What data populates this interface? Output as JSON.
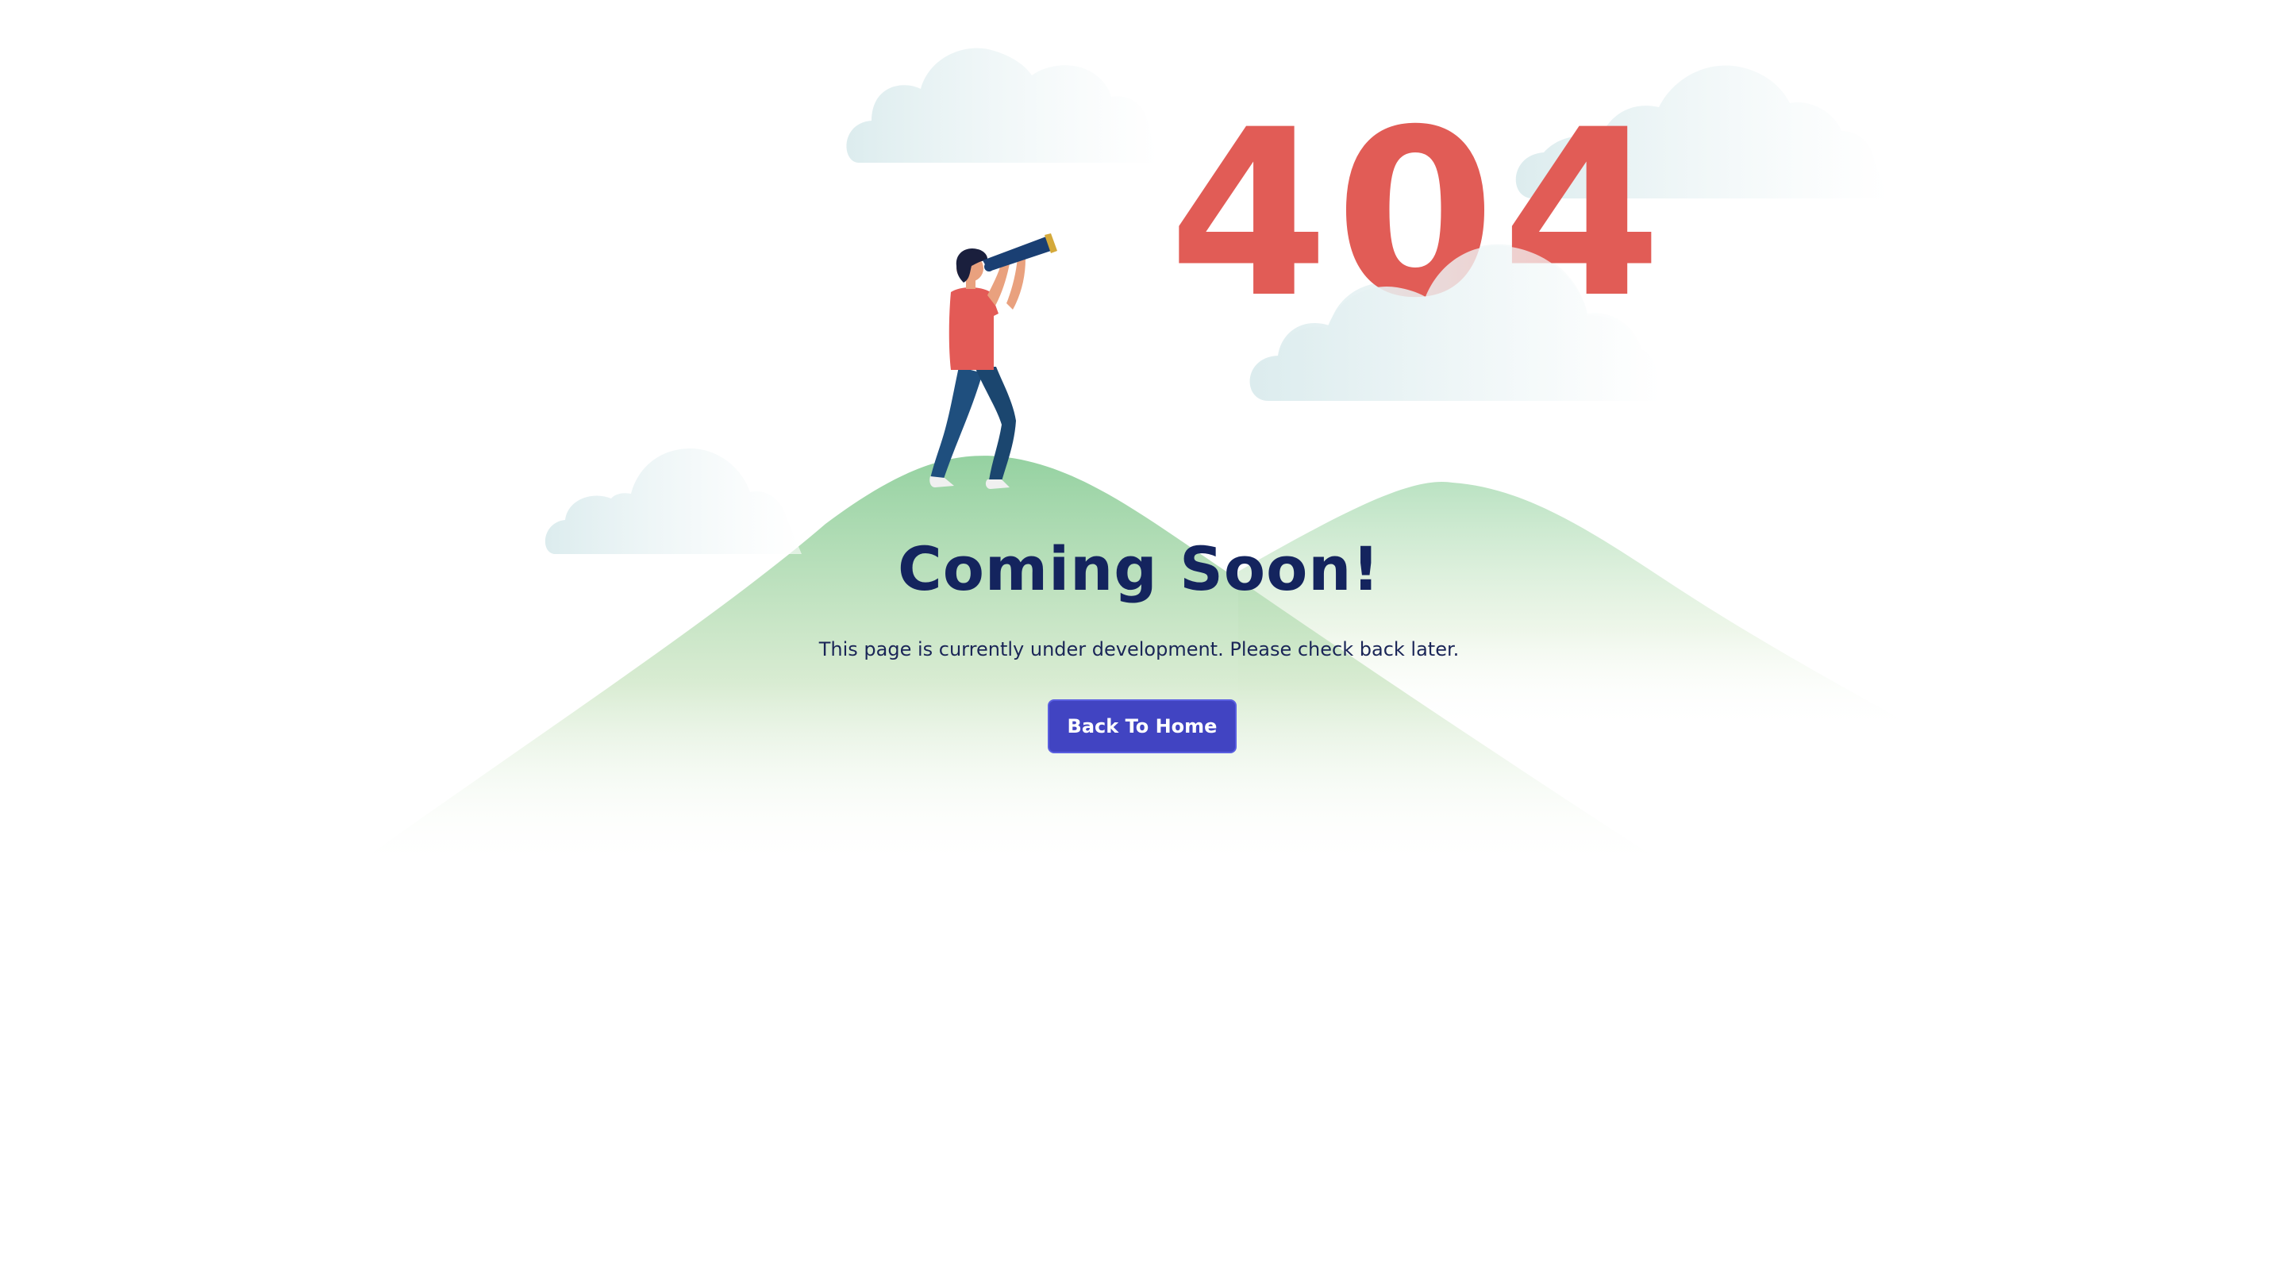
{
  "error_code": "404",
  "heading": "Coming Soon!",
  "message": "This page is currently under development. Please check back later.",
  "back_button": {
    "label": "Back To Home"
  },
  "colors": {
    "error_code": "#e15c56",
    "heading": "#14245e",
    "button_bg": "#4144c2",
    "hill": "#9dd4a8",
    "cloud": "#e1eff0",
    "person_shirt": "#e35a56",
    "person_pants": "#1f4f7e"
  }
}
